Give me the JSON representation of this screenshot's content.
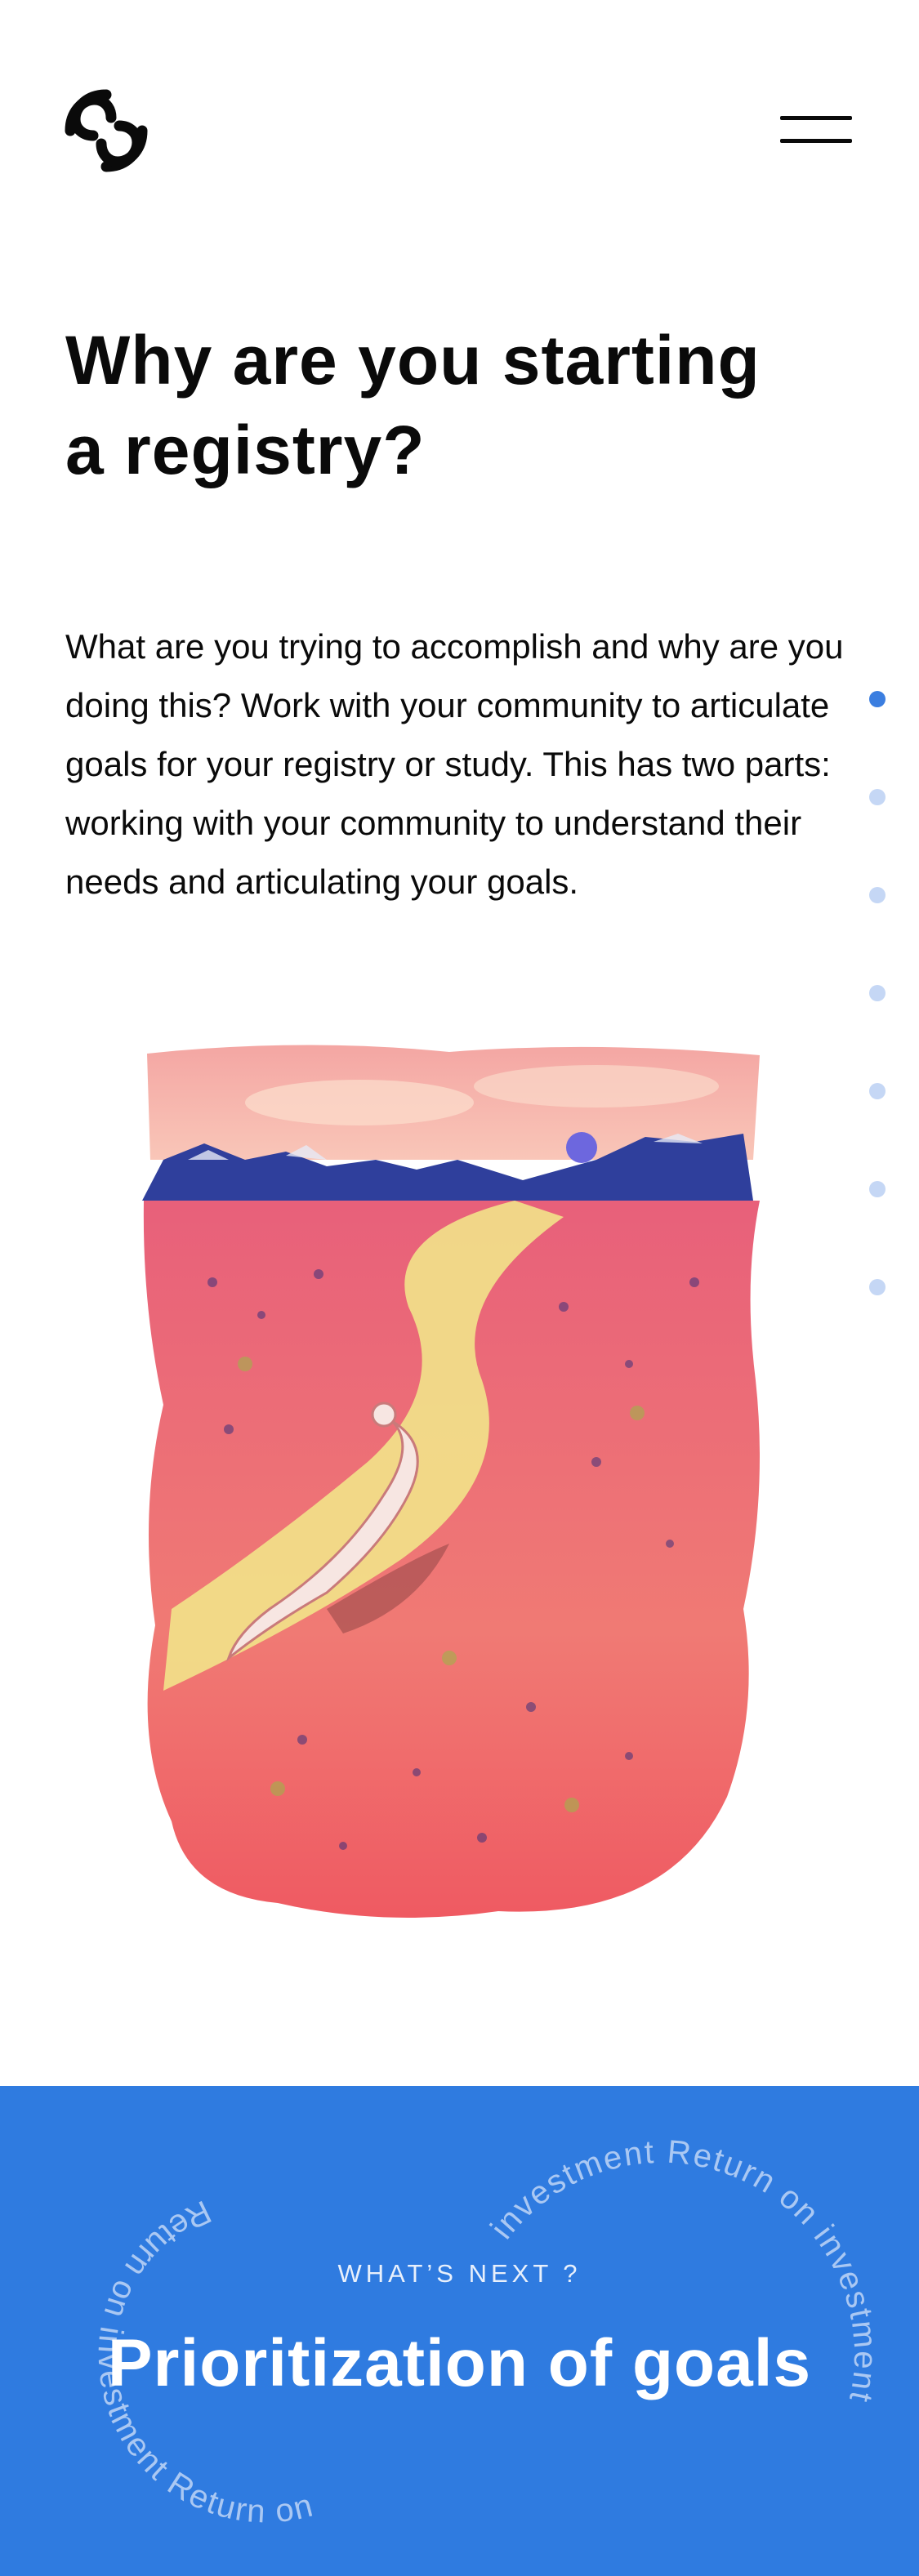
{
  "header": {
    "logo_icon": "interlocking-loops-logo",
    "menu_icon": "hamburger-menu-icon"
  },
  "section": {
    "title_line1": "Why are you starting",
    "title_line2": "a registry?",
    "body": "What are you trying to accomplish and why are you doing this? Work with your community to articulate goals for your registry or study. This has two parts: working with your community to understand their needs and articulating your goals."
  },
  "progress": {
    "total": 7,
    "active_index": 0
  },
  "illustration": {
    "subject": "watercolor of a figure lying in a pink flower field beside a winding yellow path, blue mountains and violet sun"
  },
  "next": {
    "label": "WHAT’S NEXT ?",
    "title": "Prioritization of goals",
    "ring_text_left": "Return on investment Return on",
    "ring_text_right": "investment Return on investment"
  },
  "colors": {
    "accent": "#2f7be0",
    "dot_active": "#3b7ee0",
    "dot_inactive": "#c5d7f5",
    "text": "#0a0a0a"
  }
}
